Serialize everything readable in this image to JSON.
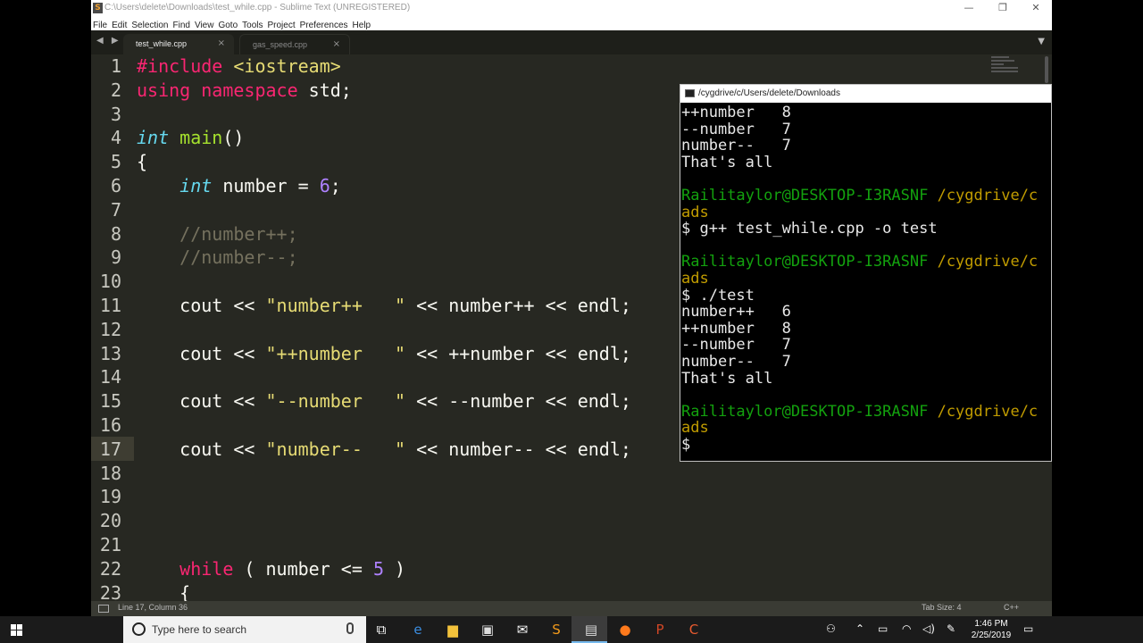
{
  "window": {
    "title": "C:\\Users\\delete\\Downloads\\test_while.cpp - Sublime Text (UNREGISTERED)",
    "minimize": "—",
    "restore": "❐",
    "close": "✕"
  },
  "menu": [
    "File",
    "Edit",
    "Selection",
    "Find",
    "View",
    "Goto",
    "Tools",
    "Project",
    "Preferences",
    "Help"
  ],
  "tabs": [
    {
      "label": "test_while.cpp",
      "active": true
    },
    {
      "label": "gas_speed.cpp",
      "active": false
    }
  ],
  "tab_nav": "◀ ▶",
  "tab_close": "×",
  "tab_dropdown": "▼",
  "code": [
    {
      "n": "1",
      "text": "#include <iostream>"
    },
    {
      "n": "2",
      "text": "using namespace std;"
    },
    {
      "n": "3",
      "text": ""
    },
    {
      "n": "4",
      "text": "int main()"
    },
    {
      "n": "5",
      "text": "{"
    },
    {
      "n": "6",
      "text": "    int number = 6;"
    },
    {
      "n": "7",
      "text": ""
    },
    {
      "n": "8",
      "text": "    //number++;"
    },
    {
      "n": "9",
      "text": "    //number--;"
    },
    {
      "n": "10",
      "text": ""
    },
    {
      "n": "11",
      "text": "    cout << \"number++   \" << number++ << endl;"
    },
    {
      "n": "12",
      "text": ""
    },
    {
      "n": "13",
      "text": "    cout << \"++number   \" << ++number << endl;"
    },
    {
      "n": "14",
      "text": ""
    },
    {
      "n": "15",
      "text": "    cout << \"--number   \" << --number << endl;"
    },
    {
      "n": "16",
      "text": ""
    },
    {
      "n": "17",
      "text": "    cout << \"number--   \" << number-- << endl;"
    },
    {
      "n": "18",
      "text": ""
    },
    {
      "n": "19",
      "text": ""
    },
    {
      "n": "20",
      "text": ""
    },
    {
      "n": "21",
      "text": ""
    },
    {
      "n": "22",
      "text": "    while ( number <= 5 )"
    },
    {
      "n": "23",
      "text": "    {"
    }
  ],
  "status": {
    "position": "Line 17, Column 36",
    "tab_size": "Tab Size: 4",
    "syntax": "C++"
  },
  "terminal": {
    "title": "/cygdrive/c/Users/delete/Downloads",
    "lines": [
      {
        "text": "++number   8",
        "color": "white"
      },
      {
        "text": "--number   7",
        "color": "white"
      },
      {
        "text": "number--   7",
        "color": "white"
      },
      {
        "text": "That's all",
        "color": "white"
      },
      {
        "text": "",
        "color": "white"
      },
      {
        "user": "Railitaylor@DESKTOP-I3RASNF",
        "path": " /cygdrive/c"
      },
      {
        "text": "ads",
        "color": "yellow"
      },
      {
        "text": "$ g++ test_while.cpp -o test",
        "color": "white"
      },
      {
        "text": "",
        "color": "white"
      },
      {
        "user": "Railitaylor@DESKTOP-I3RASNF",
        "path": " /cygdrive/c"
      },
      {
        "text": "ads",
        "color": "yellow"
      },
      {
        "text": "$ ./test",
        "color": "white"
      },
      {
        "text": "number++   6",
        "color": "white"
      },
      {
        "text": "++number   8",
        "color": "white"
      },
      {
        "text": "--number   7",
        "color": "white"
      },
      {
        "text": "number--   7",
        "color": "white"
      },
      {
        "text": "That's all",
        "color": "white"
      },
      {
        "text": "",
        "color": "white"
      },
      {
        "user": "Railitaylor@DESKTOP-I3RASNF",
        "path": " /cygdrive/c"
      },
      {
        "text": "ads",
        "color": "yellow"
      },
      {
        "text": "$",
        "color": "white"
      }
    ]
  },
  "taskbar": {
    "search_placeholder": "Type here to search",
    "time": "1:46 PM",
    "date": "2/25/2019",
    "apps": [
      {
        "icon": "task-view-icon",
        "glyph": "⧉",
        "color": "#ffffff"
      },
      {
        "icon": "edge-icon",
        "glyph": "e",
        "color": "#3b8de0"
      },
      {
        "icon": "file-explorer-icon",
        "glyph": "▆",
        "color": "#f3c23b"
      },
      {
        "icon": "store-icon",
        "glyph": "▣",
        "color": "#dddddd"
      },
      {
        "icon": "mail-icon",
        "glyph": "✉",
        "color": "#ffffff"
      },
      {
        "icon": "sublime-icon",
        "glyph": "S",
        "color": "#f29a1b"
      },
      {
        "icon": "terminal-icon",
        "glyph": "▤",
        "color": "#dddddd"
      },
      {
        "icon": "firefox-icon",
        "glyph": "●",
        "color": "#ff7a1c"
      },
      {
        "icon": "powerpoint-icon",
        "glyph": "P",
        "color": "#d24726"
      },
      {
        "icon": "codecademy-icon",
        "glyph": "C",
        "color": "#e85a2f"
      }
    ],
    "tray": [
      {
        "icon": "people-icon",
        "glyph": "⚇"
      },
      {
        "icon": "chevron-up-icon",
        "glyph": "⌃"
      },
      {
        "icon": "battery-icon",
        "glyph": "▭"
      },
      {
        "icon": "wifi-icon",
        "glyph": "◠"
      },
      {
        "icon": "volume-icon",
        "glyph": "◁)"
      },
      {
        "icon": "pen-icon",
        "glyph": "✎"
      }
    ],
    "notification_glyph": "▭"
  },
  "colors": {
    "editor_bg": "#272822",
    "keyword": "#f92672",
    "type": "#66d9ef",
    "function": "#a6e22e",
    "string": "#e6db74",
    "number": "#ae81ff",
    "comment": "#75715e",
    "prompt_user": "#13a10e",
    "prompt_path": "#c19c00"
  }
}
